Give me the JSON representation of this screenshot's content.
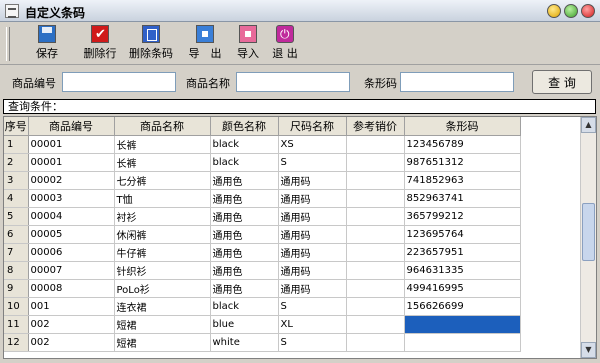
{
  "window": {
    "title": "自定义条码"
  },
  "toolbar": {
    "buttons": [
      {
        "label": "保存",
        "icon": "save-icon"
      },
      {
        "label": "删除行",
        "icon": "delete-row-icon"
      },
      {
        "label": "删除条码",
        "icon": "delete-barcode-icon"
      },
      {
        "label": "导　出",
        "icon": "export-icon"
      },
      {
        "label": "导入",
        "icon": "import-icon"
      },
      {
        "label": "退 出",
        "icon": "exit-icon"
      }
    ]
  },
  "search": {
    "code_label": "商品编号",
    "code_value": "",
    "name_label": "商品名称",
    "name_value": "",
    "barcode_label": "条形码",
    "barcode_value": "",
    "query_button": "查 询"
  },
  "condition_bar": {
    "text": "查询条件："
  },
  "table": {
    "columns": [
      "序号",
      "商品编号",
      "商品名称",
      "颜色名称",
      "尺码名称",
      "参考销价",
      "条形码"
    ],
    "rows": [
      [
        "1",
        "00001",
        "长裤",
        "black",
        "XS",
        "",
        "123456789"
      ],
      [
        "2",
        "00001",
        "长裤",
        "black",
        "S",
        "",
        "987651312"
      ],
      [
        "3",
        "00002",
        "七分裤",
        "通用色",
        "通用码",
        "",
        "741852963"
      ],
      [
        "4",
        "00003",
        "T恤",
        "通用色",
        "通用码",
        "",
        "852963741"
      ],
      [
        "5",
        "00004",
        "衬衫",
        "通用色",
        "通用码",
        "",
        "365799212"
      ],
      [
        "6",
        "00005",
        "休闲裤",
        "通用色",
        "通用码",
        "",
        "123695764"
      ],
      [
        "7",
        "00006",
        "牛仔裤",
        "通用色",
        "通用码",
        "",
        "223657951"
      ],
      [
        "8",
        "00007",
        "针织衫",
        "通用色",
        "通用码",
        "",
        "964631335"
      ],
      [
        "9",
        "00008",
        "PoLo衫",
        "通用色",
        "通用码",
        "",
        "499416995"
      ],
      [
        "10",
        "001",
        "连衣裙",
        "black",
        "S",
        "",
        "156626699"
      ],
      [
        "11",
        "002",
        "短裙",
        "blue",
        "XL",
        "",
        ""
      ],
      [
        "12",
        "002",
        "短裙",
        "white",
        "S",
        "",
        ""
      ]
    ]
  },
  "colors": {
    "selection": "#1c5fbc",
    "header_bg": "#e8e4d8"
  }
}
